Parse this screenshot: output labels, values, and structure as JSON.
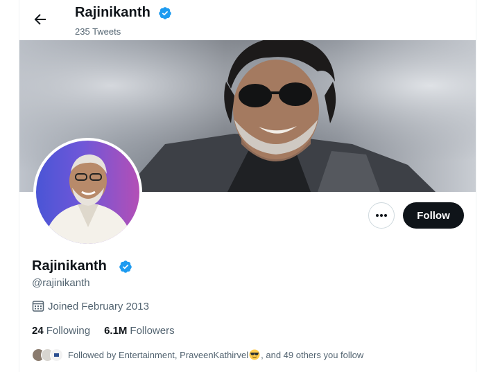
{
  "header": {
    "name": "Rajinikanth",
    "tweet_count": "235 Tweets",
    "back_icon": "arrow-left-icon"
  },
  "profile": {
    "name": "Rajinikanth",
    "handle": "@rajinikanth",
    "joined": "Joined February 2013",
    "verified_color": "#1d9bf0"
  },
  "actions": {
    "more_icon": "more-horizontal-icon",
    "follow_label": "Follow"
  },
  "stats": {
    "following_count": "24",
    "following_label": "Following",
    "followers_count": "6.1M",
    "followers_label": "Followers"
  },
  "followed_by": {
    "prefix": "Followed by Entertainment, PraveenKathirvel",
    "emoji": "smiling-face-with-sunglasses",
    "suffix": ", and 49 others you follow"
  }
}
